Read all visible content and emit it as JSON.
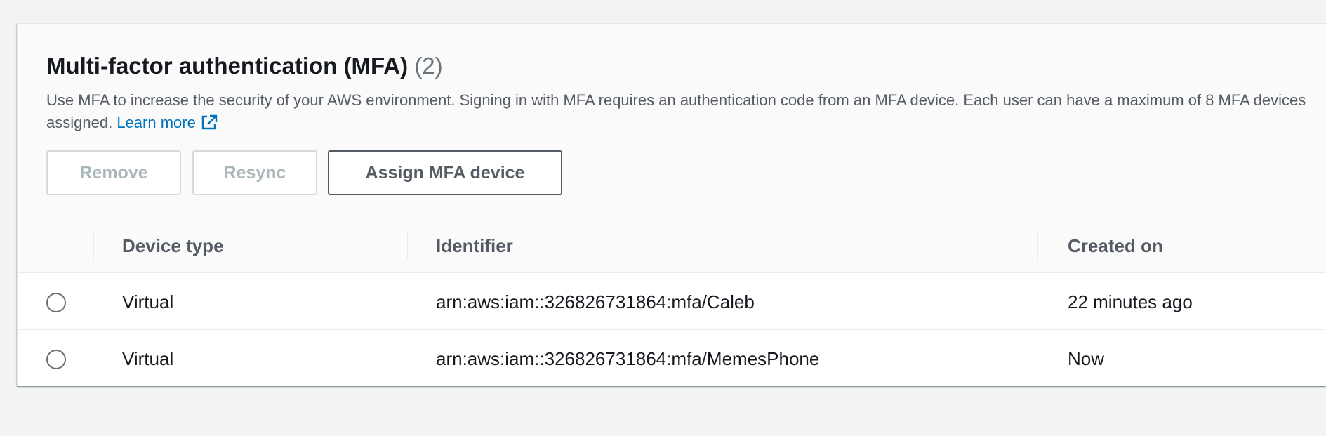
{
  "mfa": {
    "title": "Multi-factor authentication (MFA)",
    "count": "(2)",
    "description": "Use MFA to increase the security of your AWS environment. Signing in with MFA requires an authentication code from an MFA device. Each user can have a maximum of 8 MFA devices assigned.",
    "learn_more": "Learn more",
    "learn_more_icon": "external-link-icon",
    "actions": {
      "remove": "Remove",
      "resync": "Resync",
      "assign": "Assign MFA device"
    },
    "columns": {
      "device_type": "Device type",
      "identifier": "Identifier",
      "created_on": "Created on"
    },
    "devices": [
      {
        "device_type": "Virtual",
        "identifier": "arn:aws:iam::326826731864:mfa/Caleb",
        "created_on": "22 minutes ago",
        "selected": false
      },
      {
        "device_type": "Virtual",
        "identifier": "arn:aws:iam::326826731864:mfa/MemesPhone",
        "created_on": "Now",
        "selected": false
      }
    ]
  },
  "colors": {
    "page_bg": "#f2f3f3",
    "link": "#0073bb",
    "text_primary": "#16191f",
    "text_secondary": "#545b64",
    "disabled": "#aab7b8"
  }
}
